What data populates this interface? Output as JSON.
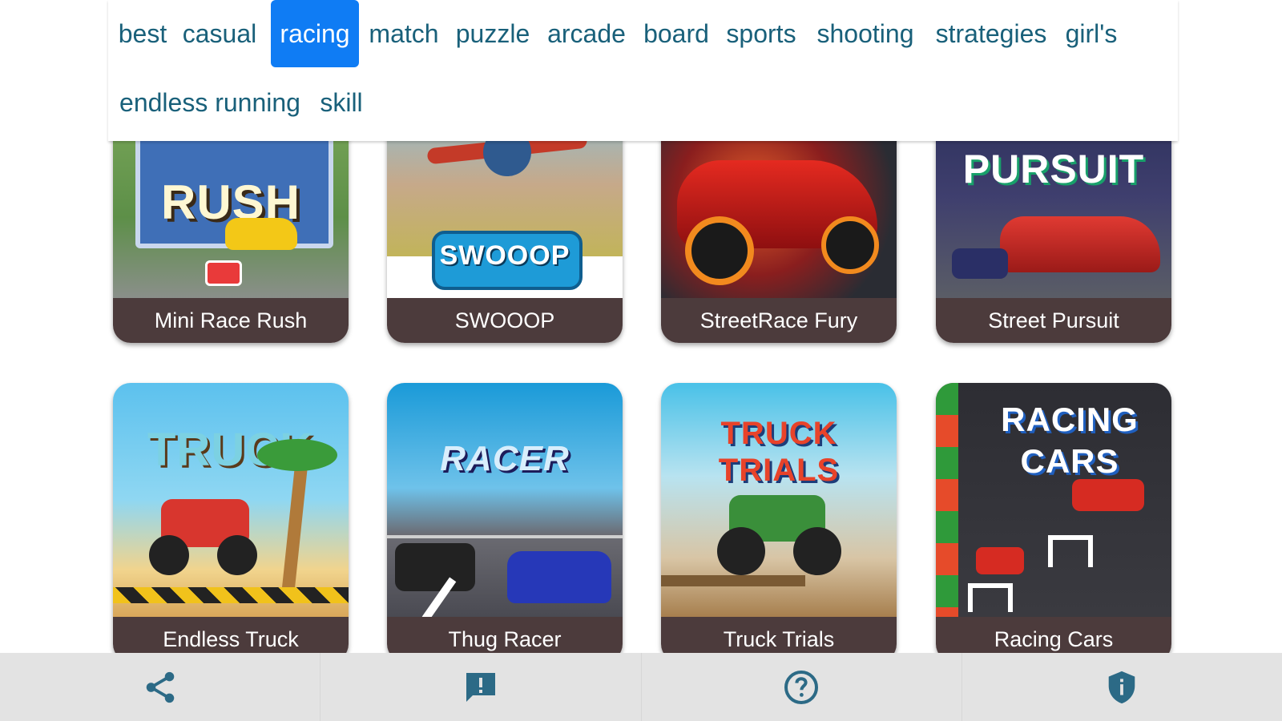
{
  "categories": [
    {
      "label": "best"
    },
    {
      "label": "casual"
    },
    {
      "label": "racing",
      "active": true
    },
    {
      "label": "match"
    },
    {
      "label": "puzzle"
    },
    {
      "label": "arcade"
    },
    {
      "label": "board"
    },
    {
      "label": "sports"
    },
    {
      "label": "shooting"
    },
    {
      "label": "strategies"
    },
    {
      "label": "girl's"
    },
    {
      "label": "endless running"
    },
    {
      "label": "skill"
    }
  ],
  "games_row1": [
    {
      "title": "Mini Race Rush",
      "art_text": "RUSH"
    },
    {
      "title": "SWOOOP",
      "art_text": "SWOOOP"
    },
    {
      "title": "StreetRace Fury",
      "art_text": ""
    },
    {
      "title": "Street Pursuit",
      "art_text": "PURSUIT"
    }
  ],
  "games_row2": [
    {
      "title": "Endless Truck",
      "art_text": "TRUCK"
    },
    {
      "title": "Thug Racer",
      "art_text": "RACER"
    },
    {
      "title": "Truck Trials",
      "art_text": "TRUCK TRIALS"
    },
    {
      "title": "Racing Cars",
      "art_text": "RACING CARS"
    }
  ],
  "colors": {
    "accent": "#0f7cf4",
    "category_text": "#19607a",
    "label_bg": "#4c3b3c",
    "nav_icon": "#2c6a86"
  },
  "bottom_nav": [
    {
      "icon": "share-icon"
    },
    {
      "icon": "feedback-icon"
    },
    {
      "icon": "help-icon"
    },
    {
      "icon": "privacy-shield-icon"
    }
  ]
}
